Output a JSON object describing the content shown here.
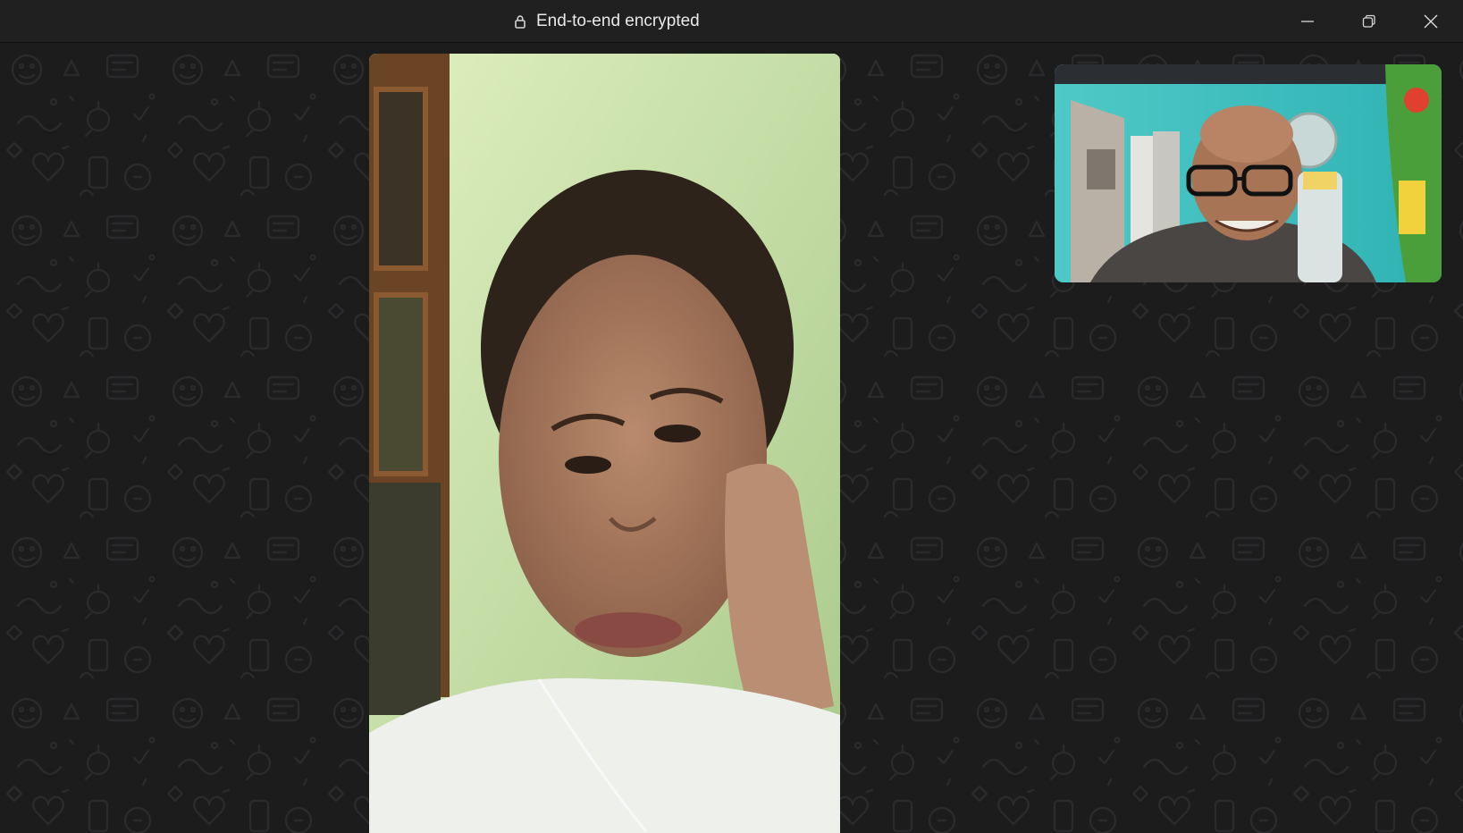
{
  "titlebar": {
    "encryption_label": "End-to-end encrypted",
    "icons": {
      "lock": "lock-icon",
      "minimize": "minimize-icon",
      "restore": "restore-icon",
      "close": "close-icon"
    }
  },
  "call": {
    "remote_video": "remote-participant-video",
    "self_video": "self-preview-video"
  },
  "colors": {
    "titlebar_bg": "#202021",
    "background": "#1c1c1d",
    "text": "#e9e9e9"
  }
}
